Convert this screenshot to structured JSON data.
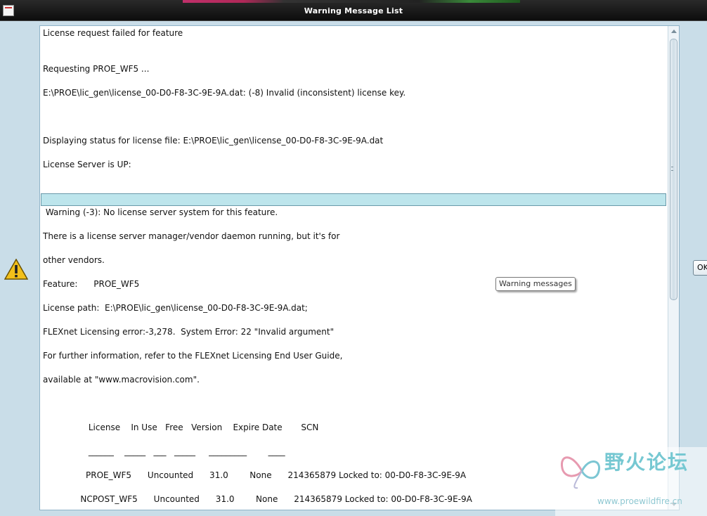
{
  "window": {
    "title": "Warning Message List"
  },
  "messages": {
    "lines": [
      "License request failed for feature",
      "",
      "",
      "Requesting PROE_WF5 ...",
      "",
      "E:\\PROE\\lic_gen\\license_00-D0-F8-3C-9E-9A.dat: (-8) Invalid (inconsistent) license key.",
      "",
      "",
      "",
      "Displaying status for license file: E:\\PROE\\lic_gen\\license_00-D0-F8-3C-9E-9A.dat",
      "",
      "License Server is UP:",
      "",
      "",
      "",
      " Warning (-3): No license server system for this feature.",
      "",
      "There is a license server manager/vendor daemon running, but it's for",
      "",
      "other vendors.",
      "",
      "Feature:      PROE_WF5",
      "",
      "License path:  E:\\PROE\\lic_gen\\license_00-D0-F8-3C-9E-9A.dat;",
      "",
      "FLEXnet Licensing error:-3,278.  System Error: 22 \"Invalid argument\"",
      "",
      "For further information, refer to the FLEXnet Licensing End User Guide,",
      "",
      "available at \"www.macrovision.com\".",
      "",
      "",
      "",
      "                 License    In Use   Free   Version    Expire Date       SCN",
      "",
      "                 ______    _____   ___   _____     _________        ____",
      "",
      "                PROE_WF5      Uncounted      31.0        None      214365879 Locked to: 00-D0-F8-3C-9E-9A",
      "",
      "              NCPOST_WF5      Uncounted      31.0        None      214365879 Locked to: 00-D0-F8-3C-9E-9A"
    ]
  },
  "tooltip": {
    "text": "Warning messages"
  },
  "ok_button": {
    "label": "OK"
  },
  "watermark": {
    "cn_text": "野火论坛",
    "url": "www.proewildfire.cn"
  },
  "icons": {
    "app": "app-icon",
    "warning": "warning-triangle-icon"
  },
  "colors": {
    "selection": "#bde5ec",
    "window_bg": "#c9dde8",
    "titlebar": "#111111",
    "warning_fill": "#f2c01a"
  }
}
